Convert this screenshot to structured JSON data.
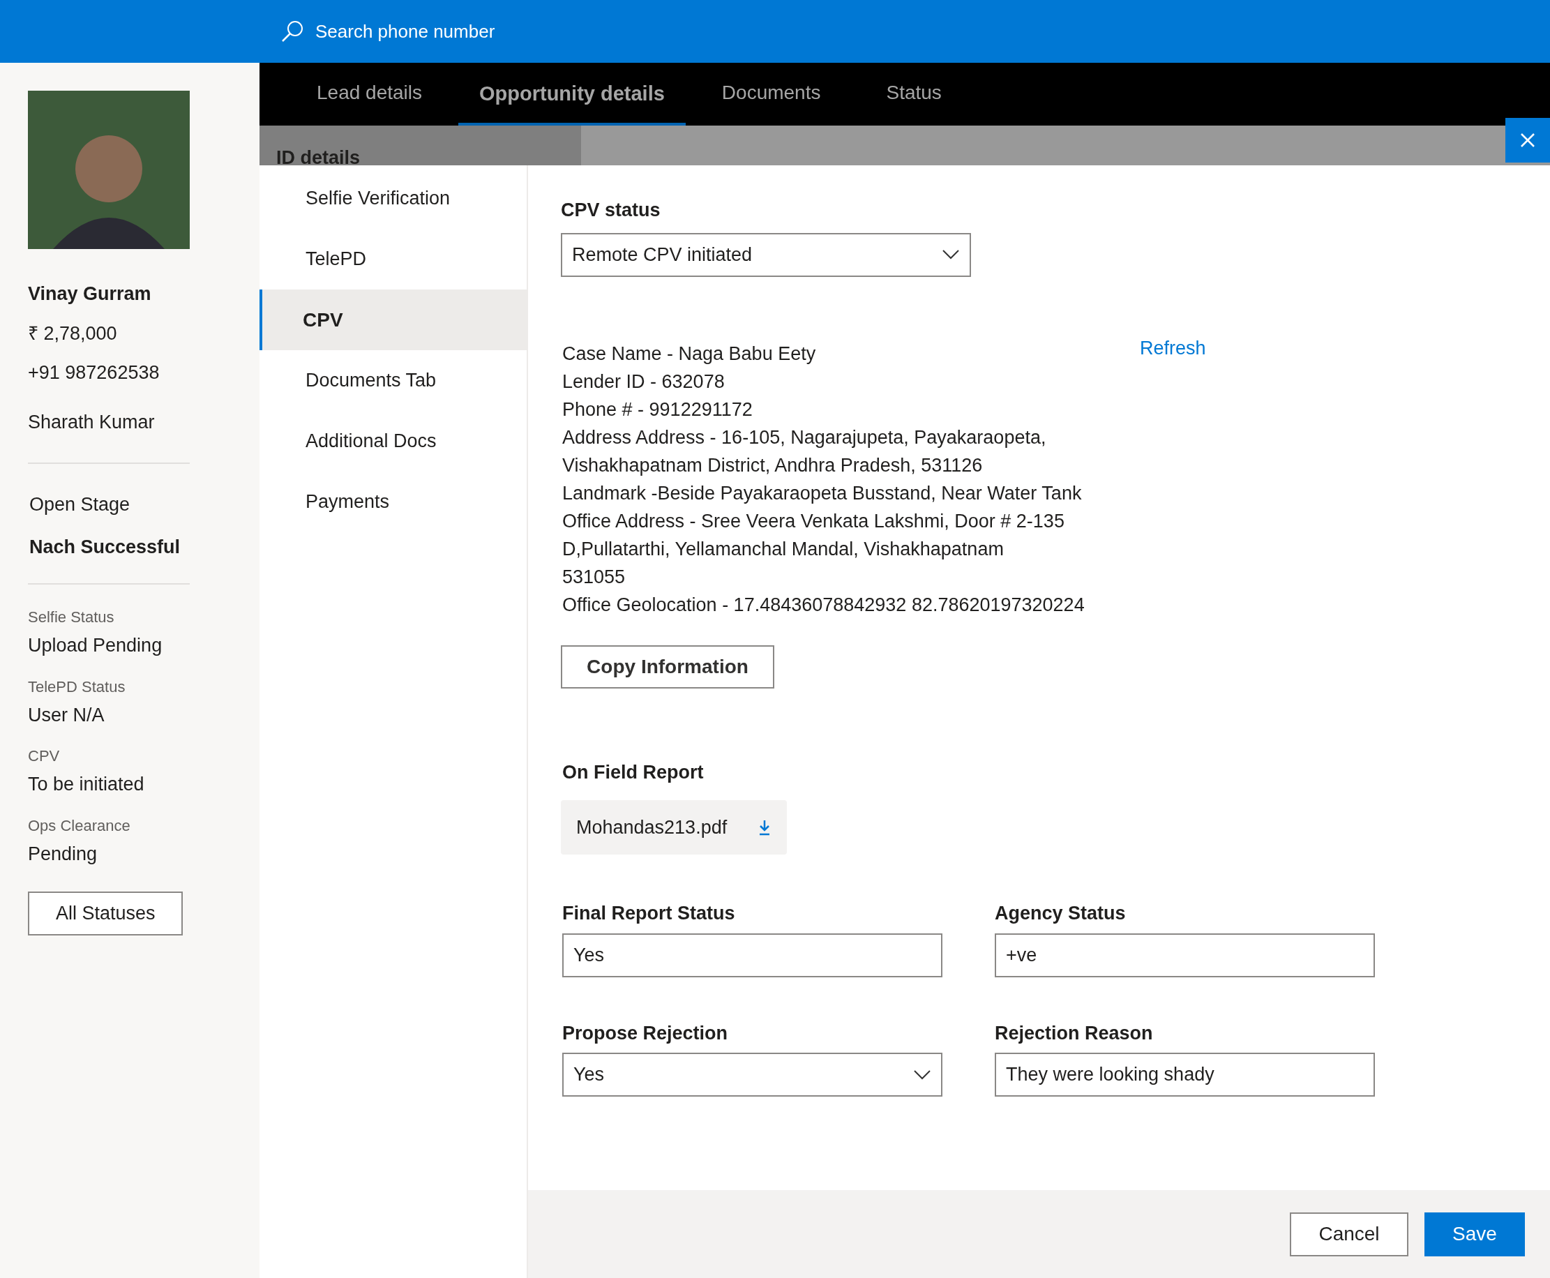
{
  "search": {
    "placeholder": "Search phone number"
  },
  "profile": {
    "name": "Vinay Gurram",
    "amount": "₹ 2,78,000",
    "phone": "+91 987262538",
    "agent": "Sharath Kumar",
    "stage": "Open Stage",
    "stage_status": "Nach Successful",
    "statuses": [
      {
        "label": "Selfie Status",
        "value": "Upload Pending"
      },
      {
        "label": "TelePD Status",
        "value": "User N/A"
      },
      {
        "label": "CPV",
        "value": "To be initiated"
      },
      {
        "label": "Ops Clearance",
        "value": "Pending"
      }
    ],
    "all_statuses_button": "All Statuses"
  },
  "tabs": [
    {
      "label": "Lead details",
      "selected": false
    },
    {
      "label": "Opportunity details",
      "selected": true
    },
    {
      "label": "Documents",
      "selected": false
    },
    {
      "label": "Status",
      "selected": false
    }
  ],
  "section_title": "ID details",
  "nav": [
    {
      "label": "Selfie Verification",
      "selected": false
    },
    {
      "label": "TelePD",
      "selected": false
    },
    {
      "label": "CPV",
      "selected": true
    },
    {
      "label": "Documents Tab",
      "selected": false
    },
    {
      "label": "Additional Docs",
      "selected": false
    },
    {
      "label": "Payments",
      "selected": false
    }
  ],
  "cpv_status": {
    "label": "CPV status",
    "value": "Remote CPV initiated"
  },
  "refresh_link": "Refresh",
  "info_lines": [
    "Case Name - Naga Babu Eety",
    "Lender ID - 632078",
    "Phone # - 9912291172",
    "Address Address - 16-105, Nagarajupeta, Payakaraopeta,",
    "Vishakhapatnam District, Andhra Pradesh, 531126",
    "Landmark -Beside Payakaraopeta Busstand, Near Water Tank",
    "Office Address - Sree Veera Venkata Lakshmi, Door # 2-135",
    "D,Pullatarthi, Yellamanchal Mandal, Vishakhapatnam",
    "531055",
    "Office Geolocation - 17.48436078842932 82.78620197320224"
  ],
  "copy_button": "Copy Information",
  "on_field_report": {
    "label": "On Field Report",
    "file": "Mohandas213.pdf"
  },
  "fields": [
    {
      "kind": "input",
      "label": "Final Report Status",
      "value": "Yes"
    },
    {
      "kind": "input",
      "label": "Agency Status",
      "value": "+ve"
    },
    {
      "kind": "select",
      "label": "Propose Rejection",
      "value": "Yes"
    },
    {
      "kind": "input",
      "label": "Rejection Reason",
      "value": "They were looking shady"
    }
  ],
  "footer": {
    "cancel": "Cancel",
    "save": "Save"
  }
}
